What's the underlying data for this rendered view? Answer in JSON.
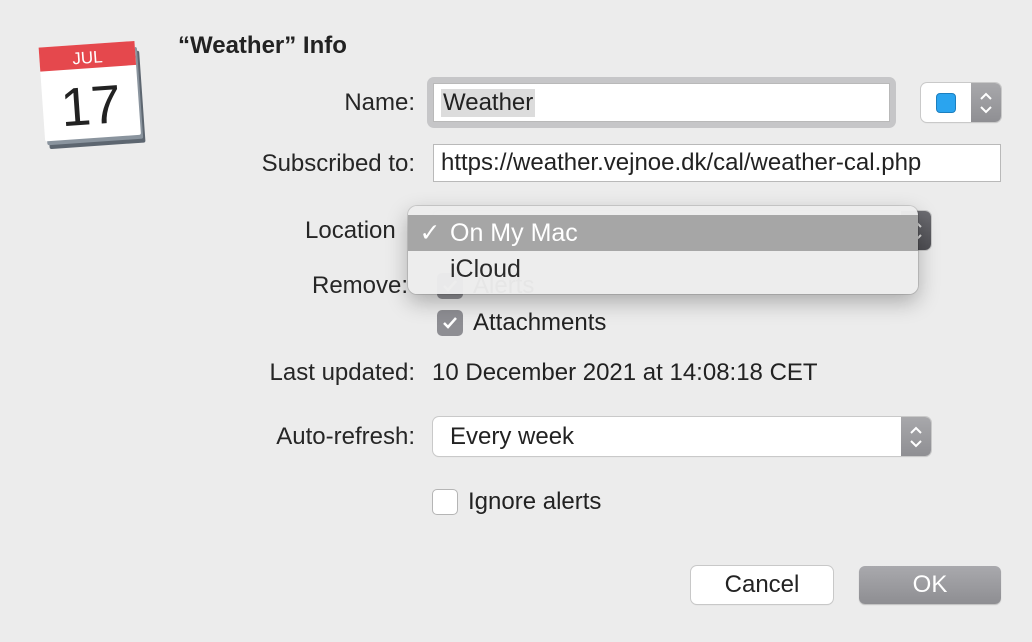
{
  "dialog": {
    "title": "“Weather” Info",
    "app_icon": {
      "name": "calendar-icon",
      "month": "JUL",
      "day": "17",
      "accent": "#e5484d"
    }
  },
  "form": {
    "name": {
      "label": "Name:",
      "value": "Weather"
    },
    "color": {
      "swatch": "#2aa4ef"
    },
    "subscribed": {
      "label": "Subscribed to:",
      "value": "https://weather.vejnoe.dk/cal/weather-cal.php"
    },
    "location": {
      "label": "Location",
      "selected": "On My Mac",
      "options": [
        {
          "label": "On My Mac",
          "checked": true
        },
        {
          "label": "iCloud",
          "checked": false
        }
      ]
    },
    "remove": {
      "label": "Remove:",
      "items": [
        {
          "label": "Alerts",
          "checked": true
        },
        {
          "label": "Attachments",
          "checked": true
        }
      ]
    },
    "last_updated": {
      "label": "Last updated:",
      "value": "10 December 2021 at 14:08:18 CET"
    },
    "auto_refresh": {
      "label": "Auto-refresh:",
      "value": "Every week"
    },
    "ignore_alerts": {
      "label": "Ignore alerts",
      "checked": false
    }
  },
  "buttons": {
    "cancel": "Cancel",
    "ok": "OK"
  },
  "glyphs": {
    "check": "✓"
  }
}
